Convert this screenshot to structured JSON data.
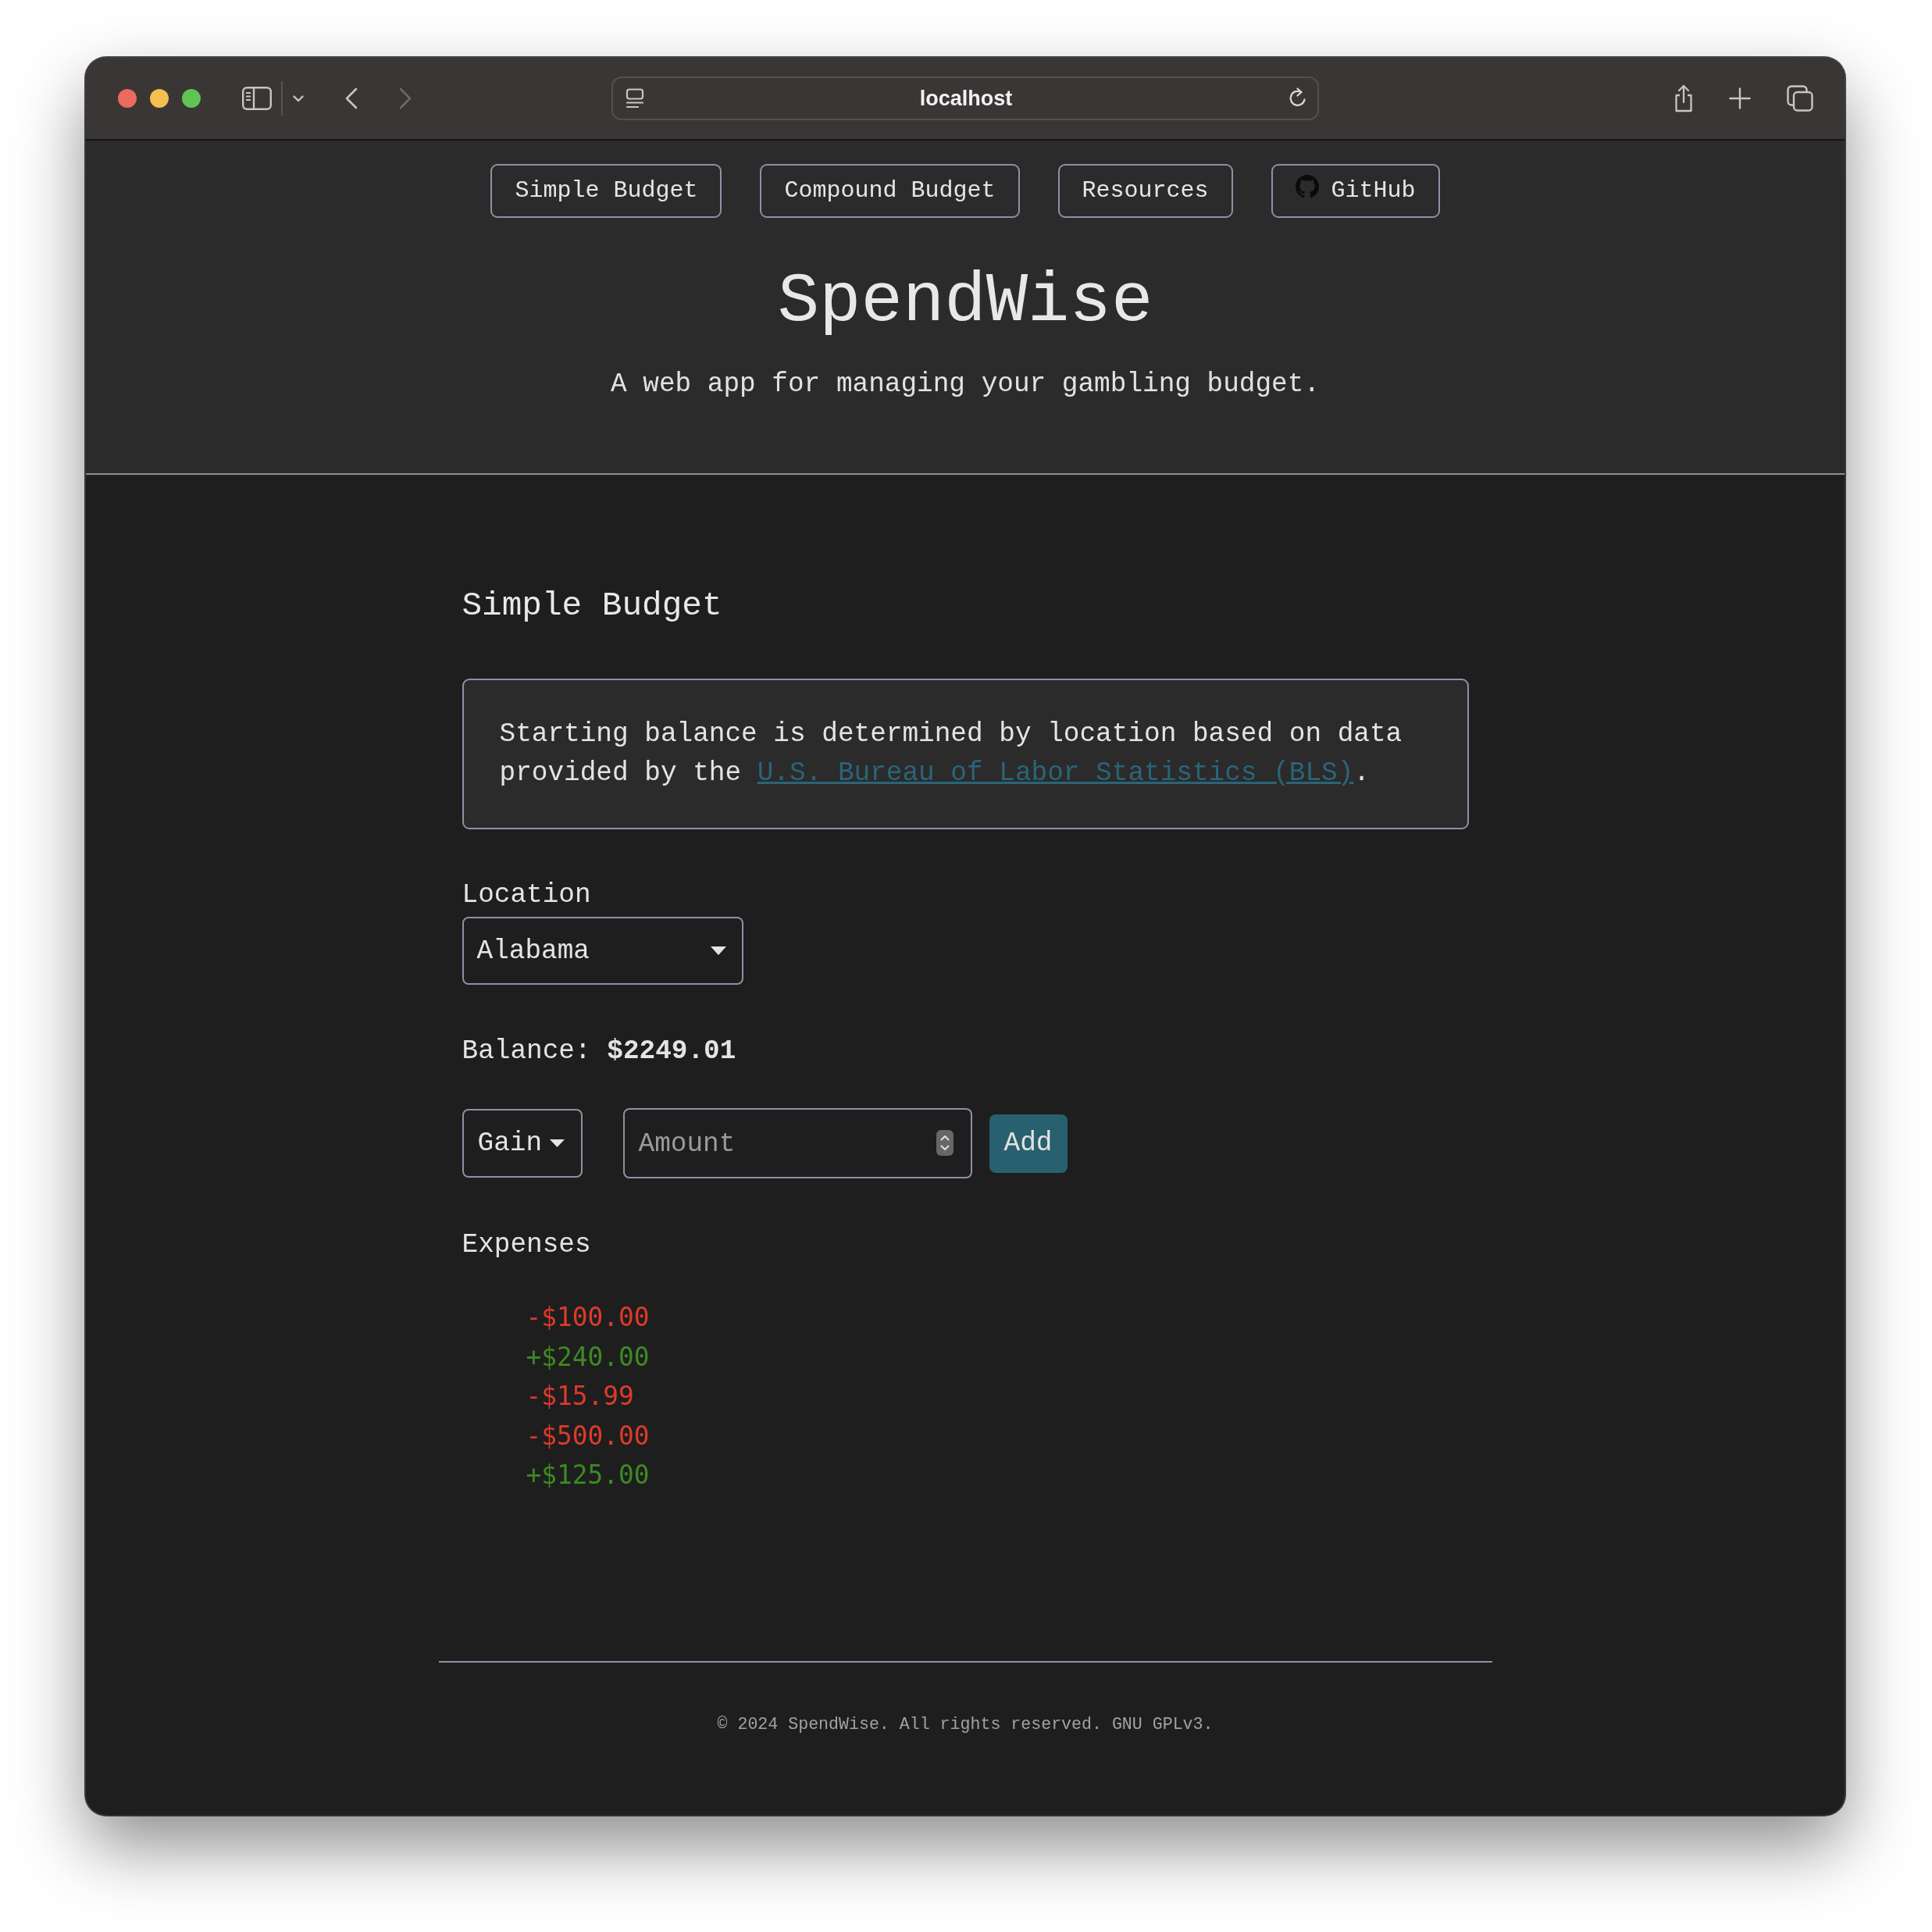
{
  "browser": {
    "address": "localhost",
    "nav_buttons": [
      {
        "kind": "back",
        "disabled": false
      },
      {
        "kind": "forward",
        "disabled": true
      }
    ]
  },
  "nav": [
    {
      "label": "Simple Budget",
      "kind": "text"
    },
    {
      "label": "Compound Budget",
      "kind": "text"
    },
    {
      "label": "Resources",
      "kind": "text"
    },
    {
      "label": "GitHub",
      "kind": "github"
    }
  ],
  "header": {
    "title": "SpendWise",
    "tagline": "A web app for managing your gambling budget."
  },
  "budget": {
    "heading": "Simple Budget",
    "notice": {
      "text": "Starting balance is determined by location based on data provided by the ",
      "link": "U.S. Bureau of Labor Statistics (BLS)",
      "text_end": "."
    },
    "location": {
      "label": "Location",
      "value": "Alabama"
    },
    "balance": "Balance: **$2249.01**",
    "entry": {
      "type": "Gain",
      "amount": {
        "placeholder": "Amount"
      },
      "button": "Add"
    }
  },
  "expenses": {
    "heading": "Expenses",
    "items": [
      {
        "amount": "-$100.00",
        "color": "#dc3a2b"
      },
      {
        "amount": "+$240.00",
        "color": "#3c8a24"
      },
      {
        "amount": "-$15.99",
        "color": "#dc3a2b"
      },
      {
        "amount": "-$500.00",
        "color": "#dc3a2b"
      },
      {
        "amount": "+$125.00",
        "color": "#3c8a24"
      }
    ]
  },
  "footer": {
    "text": "© 2024 SpendWise. All rights reserved. GNU GPLv3."
  }
}
